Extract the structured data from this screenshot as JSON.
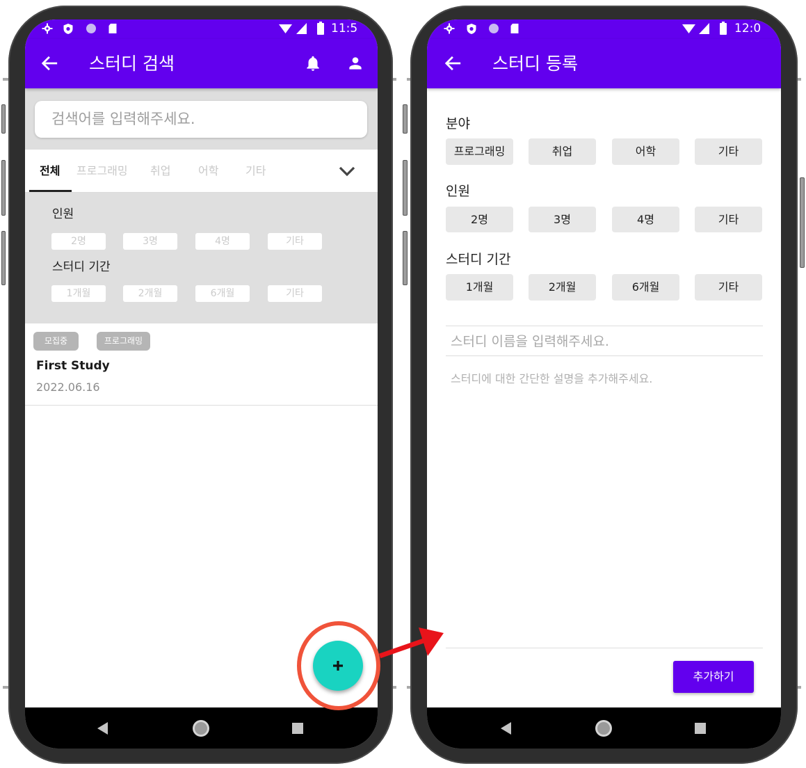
{
  "left_screen": {
    "status_bar": {
      "time": "11:5"
    },
    "app_bar": {
      "title": "스터디 검색"
    },
    "search": {
      "placeholder": "검색어를 입력해주세요."
    },
    "tabs": [
      {
        "label": "전체",
        "selected": true
      },
      {
        "label": "프로그래밍",
        "selected": false
      },
      {
        "label": "취업",
        "selected": false
      },
      {
        "label": "어학",
        "selected": false
      },
      {
        "label": "기타",
        "selected": false
      }
    ],
    "filters": {
      "headcount": {
        "label": "인원",
        "options": [
          "2명",
          "3명",
          "4명",
          "기타"
        ]
      },
      "duration": {
        "label": "스터디 기간",
        "options": [
          "1개월",
          "2개월",
          "6개월",
          "기타"
        ]
      }
    },
    "study_list": [
      {
        "status_badge": "모집중",
        "category_badge": "프로그래밍",
        "title": "First Study",
        "date": "2022.06.16"
      }
    ]
  },
  "right_screen": {
    "status_bar": {
      "time": "12:0"
    },
    "app_bar": {
      "title": "스터디 등록"
    },
    "sections": [
      {
        "label": "분야",
        "options": [
          "프로그래밍",
          "취업",
          "어학",
          "기타"
        ]
      },
      {
        "label": "인원",
        "options": [
          "2명",
          "3명",
          "4명",
          "기타"
        ]
      },
      {
        "label": "스터디 기간",
        "options": [
          "1개월",
          "2개월",
          "6개월",
          "기타"
        ]
      }
    ],
    "name_input": {
      "placeholder": "스터디 이름을 입력해주세요."
    },
    "description_input": {
      "placeholder": "스터디에 대한 간단한 설명을 추가해주세요."
    },
    "submit_button": {
      "label": "추가하기"
    }
  },
  "icons": {
    "status_left": [
      "settings-icon",
      "shield-icon",
      "dot-icon",
      "sd-card-icon"
    ],
    "status_right": [
      "wifi-icon",
      "signal-icon",
      "battery-icon"
    ],
    "app_bar": [
      "arrow-left-icon",
      "bell-icon",
      "person-icon"
    ],
    "tabs_expand": "chevron-down-icon",
    "fab": "plus-icon",
    "nav": [
      "nav-back-icon",
      "nav-home-icon",
      "nav-recents-icon"
    ],
    "annotation": [
      "highlight-circle",
      "red-arrow"
    ]
  },
  "colors": {
    "primary": "#6200ee",
    "fab": "#19d3c1",
    "highlight_circle": "#f0533a",
    "arrow": "#e8141a",
    "bezel": "#2e2e2e"
  }
}
